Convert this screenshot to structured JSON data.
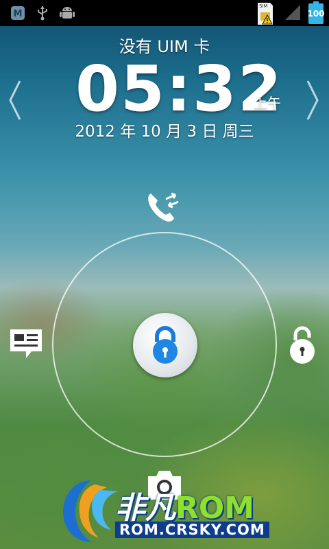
{
  "status_bar": {
    "left_icons": [
      "app-notification-icon",
      "usb-icon",
      "android-debug-icon"
    ],
    "sim_label": "SIM",
    "battery_level": "100"
  },
  "lockscreen": {
    "carrier": "没有 UIM 卡",
    "time": "05:32",
    "ampm": "上午",
    "date": "2012 年 10 月 3 日 周三"
  },
  "unlock_targets": [
    "phone-icon",
    "message-icon",
    "unlock-icon",
    "camera-icon"
  ],
  "watermark": {
    "title_part1": "非凡",
    "title_part2": "ROM",
    "url": "ROM.CRSKY.COM"
  }
}
